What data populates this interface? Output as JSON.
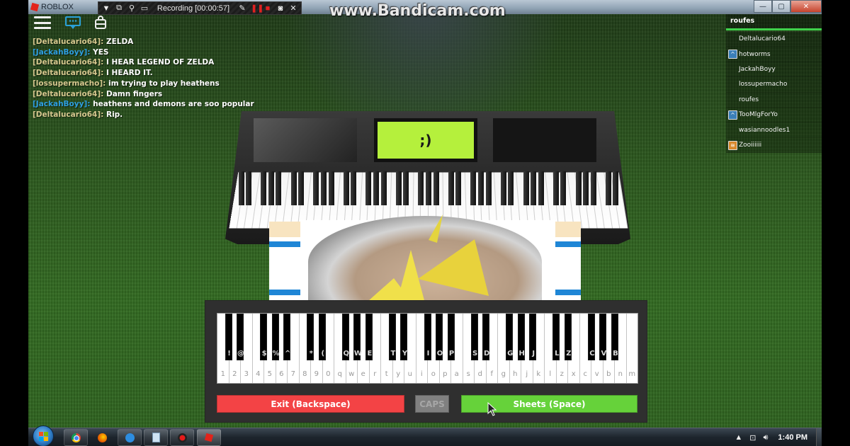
{
  "window": {
    "app_title": "ROBLOX",
    "controls": {
      "minimize": "—",
      "maximize": "▢",
      "close": "✕"
    }
  },
  "recorder": {
    "status": "Recording [00:00:57]",
    "watermark": "www.Bandicam.com",
    "icons": [
      "dropdown-icon",
      "window-icon",
      "search-icon",
      "screen-region-icon",
      "pencil-icon",
      "pause-icon",
      "stop-icon",
      "camera-icon",
      "close-icon"
    ]
  },
  "topbar": {
    "icons": [
      "menu-icon",
      "chat-icon",
      "backpack-icon"
    ]
  },
  "chat": {
    "colors": {
      "tan": "#d7c98f",
      "blue": "#2e9fe0",
      "white": "#ffffff"
    },
    "messages": [
      {
        "name": "[Deltalucario64]:",
        "text": "ZELDA",
        "color": "#d7c98f"
      },
      {
        "name": "[JackahBoyy]:",
        "text": "YES",
        "color": "#2e9fe0"
      },
      {
        "name": "[Deltalucario64]:",
        "text": "I HEAR LEGEND OF ZELDA",
        "color": "#d7c98f"
      },
      {
        "name": "[Deltalucario64]:",
        "text": "I HEARD IT.",
        "color": "#d7c98f"
      },
      {
        "name": "[lossupermacho]:",
        "text": " im trying to play heathens",
        "color": "#d7c98f"
      },
      {
        "name": "[Deltalucario64]:",
        "text": "Damn fingers",
        "color": "#d7c98f"
      },
      {
        "name": "[JackahBoyy]:",
        "text": "heathens and demons are soo popular",
        "color": "#2e9fe0"
      },
      {
        "name": "[Deltalucario64]:",
        "text": "Rip.",
        "color": "#d7c98f"
      }
    ]
  },
  "playerlist": {
    "header": "roufes",
    "accent": "#3fd24b",
    "players": [
      {
        "name": "Deltalucario64",
        "badge": null
      },
      {
        "name": "hotworms",
        "badge": "blue"
      },
      {
        "name": "JackahBoyy",
        "badge": null
      },
      {
        "name": "lossupermacho",
        "badge": null
      },
      {
        "name": "roufes",
        "badge": null
      },
      {
        "name": "TooMlgForYo",
        "badge": "blue"
      },
      {
        "name": "wasiannoodles1",
        "badge": null
      },
      {
        "name": "Zooiiiiii",
        "badge": "orange"
      }
    ]
  },
  "piano3d": {
    "display_text": ";)",
    "display_color": "#b5f03c"
  },
  "piano_ui": {
    "white_keys": [
      "1",
      "2",
      "3",
      "4",
      "5",
      "6",
      "7",
      "8",
      "9",
      "0",
      "q",
      "w",
      "e",
      "r",
      "t",
      "y",
      "u",
      "i",
      "o",
      "p",
      "a",
      "s",
      "d",
      "f",
      "g",
      "h",
      "j",
      "k",
      "l",
      "z",
      "x",
      "c",
      "v",
      "b",
      "n",
      "m"
    ],
    "black_keys": [
      {
        "label": "!",
        "after": 0
      },
      {
        "label": "@",
        "after": 1
      },
      {
        "label": "$",
        "after": 3
      },
      {
        "label": "%",
        "after": 4
      },
      {
        "label": "^",
        "after": 5
      },
      {
        "label": "*",
        "after": 7
      },
      {
        "label": "(",
        "after": 8
      },
      {
        "label": "Q",
        "after": 10
      },
      {
        "label": "W",
        "after": 11
      },
      {
        "label": "E",
        "after": 12
      },
      {
        "label": "T",
        "after": 14
      },
      {
        "label": "Y",
        "after": 15
      },
      {
        "label": "I",
        "after": 17
      },
      {
        "label": "O",
        "after": 18
      },
      {
        "label": "P",
        "after": 19
      },
      {
        "label": "S",
        "after": 21
      },
      {
        "label": "D",
        "after": 22
      },
      {
        "label": "G",
        "after": 24
      },
      {
        "label": "H",
        "after": 25
      },
      {
        "label": "J",
        "after": 26
      },
      {
        "label": "L",
        "after": 28
      },
      {
        "label": "Z",
        "after": 29
      },
      {
        "label": "C",
        "after": 31
      },
      {
        "label": "V",
        "after": 32
      },
      {
        "label": "B",
        "after": 33
      }
    ],
    "buttons": {
      "exit": "Exit (Backspace)",
      "caps": "CAPS",
      "sheets": "Sheets (Space)"
    },
    "colors": {
      "exit": "#f34345",
      "caps": "#808080",
      "sheets": "#66d23a"
    }
  },
  "taskbar": {
    "items": [
      "start-button",
      "chrome",
      "firefox",
      "app",
      "notepad",
      "bandicam",
      "roblox"
    ],
    "tray": {
      "show_hidden": "▲",
      "network": "network-icon",
      "volume": "volume-icon"
    },
    "clock": "1:40 PM"
  }
}
